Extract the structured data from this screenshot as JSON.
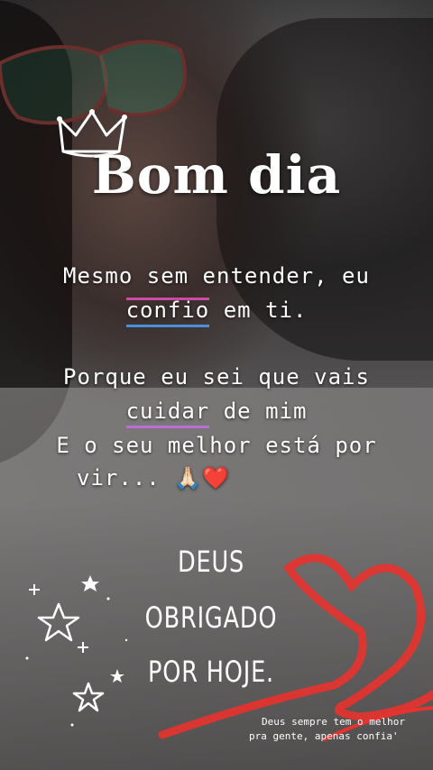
{
  "story": {
    "title": "Bom dia",
    "verse1_line1": "Mesmo sem entender, eu",
    "verse1_word": "confio",
    "verse1_end": " em ti.",
    "verse2_line1": "Porque eu sei que vais",
    "verse2_word": "cuidar",
    "verse2_end": " de mim",
    "verse2_line3": "E o seu melhor está por",
    "verse2_line4": "vir... 🙏🏻❤️",
    "gratitude_line1": "DEUS",
    "gratitude_line2": "OBRIGADO",
    "gratitude_line3": "POR HOJE.",
    "footer_line1": "Deus sempre tem o melhor",
    "footer_line2": "pra gente, apenas confia'"
  },
  "colors": {
    "heart_red": "#e8322e",
    "underline_blue": "#4a8fd8",
    "underline_pink": "#c46ad6"
  },
  "icons": [
    "crown-icon",
    "star-icon",
    "heart-doodle"
  ]
}
